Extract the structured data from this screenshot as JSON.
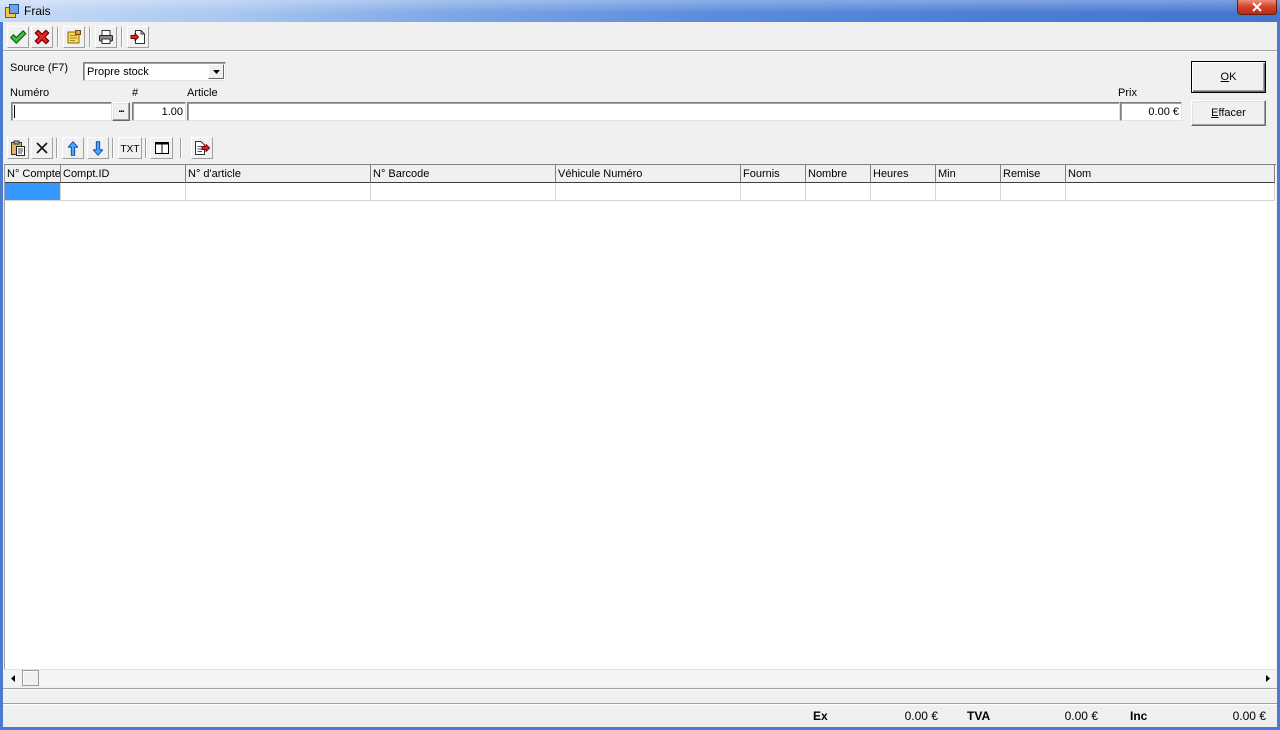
{
  "window": {
    "title": "Frais",
    "icon": "app-icon",
    "close_icon": "close-icon"
  },
  "toolbar": {
    "buttons": [
      {
        "icon": "check-icon"
      },
      {
        "icon": "red-x-icon"
      },
      {
        "icon": "note-icon"
      },
      {
        "icon": "printer-icon"
      },
      {
        "icon": "export-icon"
      }
    ]
  },
  "form": {
    "source": {
      "label": "Source (F7)",
      "value": "Propre stock",
      "icon": "chevron-down-icon"
    },
    "numero": {
      "label": "Numéro",
      "value": "",
      "browse_label": "..."
    },
    "quantity": {
      "label": "#",
      "value": "1.00"
    },
    "article": {
      "label": "Article",
      "value": ""
    },
    "prix": {
      "label": "Prix",
      "value": "0.00 €"
    },
    "ok_label": "OK",
    "clear_label": "Effacer"
  },
  "grid_toolbar": {
    "buttons": [
      {
        "icon": "clipboard-icon"
      },
      {
        "icon": "delete-icon"
      },
      {
        "icon": "arrow-up-icon"
      },
      {
        "icon": "arrow-down-icon"
      },
      {
        "label": "TXT"
      },
      {
        "icon": "columns-icon"
      },
      {
        "icon": "export-icon"
      }
    ]
  },
  "table": {
    "columns": [
      "N° Compte",
      "Compt.ID",
      "N° d'article",
      "N° Barcode",
      "Véhicule Numéro",
      "Fournis",
      "Nombre",
      "Heures",
      "Min",
      "Remise",
      "Nom"
    ],
    "rows": [
      [
        "",
        "",
        "",
        "",
        "",
        "",
        "",
        "",
        "",
        "",
        ""
      ]
    ],
    "selected_cell": {
      "row": 0,
      "column": 0
    }
  },
  "scrollbar": {
    "left_icon": "scroll-left-icon",
    "right_icon": "scroll-right-icon"
  },
  "totals": {
    "ex": {
      "label": "Ex",
      "value": "0.00 €"
    },
    "tva": {
      "label": "TVA",
      "value": "0.00 €"
    },
    "inc": {
      "label": "Inc",
      "value": "0.00 €"
    }
  },
  "colors": {
    "selection": "#3399FF",
    "title_bar": "#4A7BD0",
    "close_button": "#D6452E",
    "dialog_background": "#F0F0F0"
  }
}
